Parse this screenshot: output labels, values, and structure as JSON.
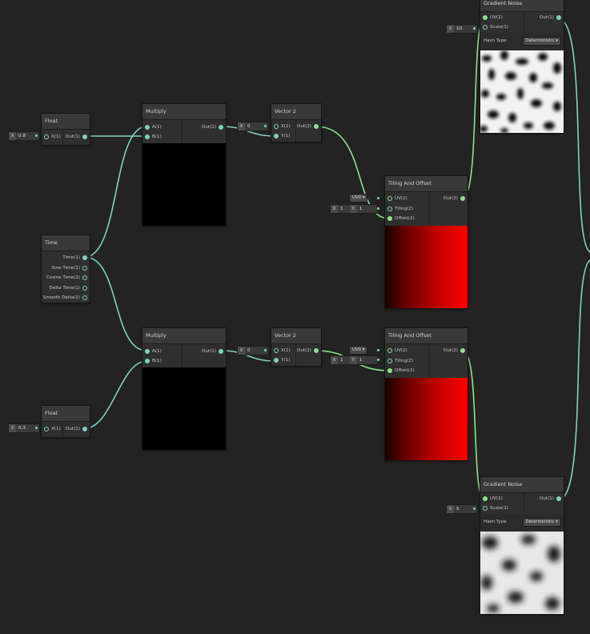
{
  "nodes": {
    "float_top": {
      "title": "Float",
      "inputs": [
        "X(1)"
      ],
      "outputs": [
        "Out(1)"
      ],
      "field_label": "X",
      "field_value": "0.8"
    },
    "float_bottom": {
      "title": "Float",
      "inputs": [
        "X(1)"
      ],
      "outputs": [
        "Out(1)"
      ],
      "field_label": "X",
      "field_value": "0.3"
    },
    "time": {
      "title": "Time",
      "outputs": [
        "Time(1)",
        "Sine Time(1)",
        "Cosine Time(1)",
        "Delta Time(1)",
        "Smooth Delta(1)"
      ]
    },
    "multiply_top": {
      "title": "Multiply",
      "inputs": [
        "A(1)",
        "B(1)"
      ],
      "outputs": [
        "Out(1)"
      ]
    },
    "multiply_bottom": {
      "title": "Multiply",
      "inputs": [
        "A(1)",
        "B(1)"
      ],
      "outputs": [
        "Out(1)"
      ]
    },
    "vector2_top": {
      "title": "Vector 2",
      "inputs": [
        "X(1)",
        "Y(1)"
      ],
      "outputs": [
        "Out(2)"
      ],
      "field_label": "X",
      "field_value": "0"
    },
    "vector2_bottom": {
      "title": "Vector 2",
      "inputs": [
        "X(1)",
        "Y(1)"
      ],
      "outputs": [
        "Out(2)"
      ],
      "field_label": "X",
      "field_value": "0"
    },
    "tiling_top": {
      "title": "Tiling And Offset",
      "inputs": [
        "UV(2)",
        "Tiling(2)",
        "Offset(2)"
      ],
      "outputs": [
        "Out(2)"
      ],
      "uv_dropdown": "UV0 ▾",
      "tiling_x_label": "X",
      "tiling_x": "1",
      "tiling_y_label": "Y",
      "tiling_y": "1"
    },
    "tiling_bottom": {
      "title": "Tiling And Offset",
      "inputs": [
        "UV(2)",
        "Tiling(2)",
        "Offset(2)"
      ],
      "outputs": [
        "Out(2)"
      ],
      "uv_dropdown": "UV0 ▾",
      "tiling_x_label": "X",
      "tiling_x": "1",
      "tiling_y_label": "Y",
      "tiling_y": "1"
    },
    "gradient_top": {
      "title": "Gradient Noise",
      "inputs": [
        "UV(2)",
        "Scale(1)"
      ],
      "outputs": [
        "Out(1)"
      ],
      "scale_label": "X",
      "scale_value": "10",
      "hash_label": "Hash Type",
      "hash_value": "Deterministic ▾"
    },
    "gradient_bottom": {
      "title": "Gradient Noise",
      "inputs": [
        "UV(2)",
        "Scale(1)"
      ],
      "outputs": [
        "Out(1)"
      ],
      "scale_label": "X",
      "scale_value": "5",
      "hash_label": "Hash Type",
      "hash_value": "Deterministic ▾"
    }
  },
  "colors": {
    "canvas": "#232323",
    "wire_float": "#7fd1c4",
    "wire_vector2": "#8be28b",
    "node_body": "#2b2b2b",
    "node_title": "#393939",
    "preview_red": "#ff0000",
    "preview_black": "#000000"
  }
}
